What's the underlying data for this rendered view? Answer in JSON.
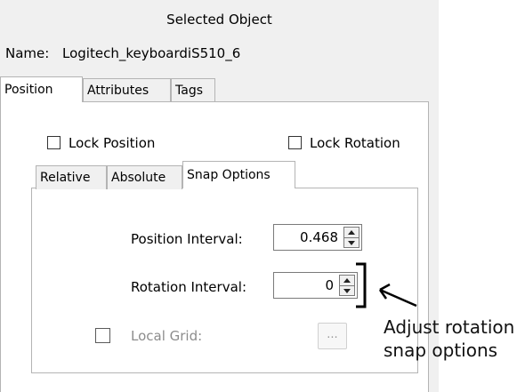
{
  "panel": {
    "title": "Selected Object",
    "name_label": "Name:",
    "name_value": "Logitech_keyboardiS510_6"
  },
  "outer_tabs": [
    {
      "label": "Position",
      "active": true
    },
    {
      "label": "Attributes",
      "active": false
    },
    {
      "label": "Tags",
      "active": false
    }
  ],
  "lock": {
    "position_label": "Lock Position",
    "position_checked": false,
    "rotation_label": "Lock Rotation",
    "rotation_checked": false
  },
  "inner_tabs": [
    {
      "label": "Relative",
      "active": false
    },
    {
      "label": "Absolute",
      "active": false
    },
    {
      "label": "Snap Options",
      "active": true
    }
  ],
  "snap": {
    "position_interval_label": "Position Interval:",
    "position_interval_value": "0.468",
    "rotation_interval_label": "Rotation Interval:",
    "rotation_interval_value": "0",
    "local_grid_label": "Local Grid:",
    "local_grid_checked": false,
    "local_grid_enabled": false,
    "browse_label": "..."
  },
  "annotation": {
    "line1": "Adjust rotation",
    "line2": "snap options"
  },
  "colors": {
    "panel_bg": "#f0f0f0",
    "page_bg": "#ffffff",
    "border": "#b4b4b4",
    "disabled_text": "#8c8c8c"
  }
}
